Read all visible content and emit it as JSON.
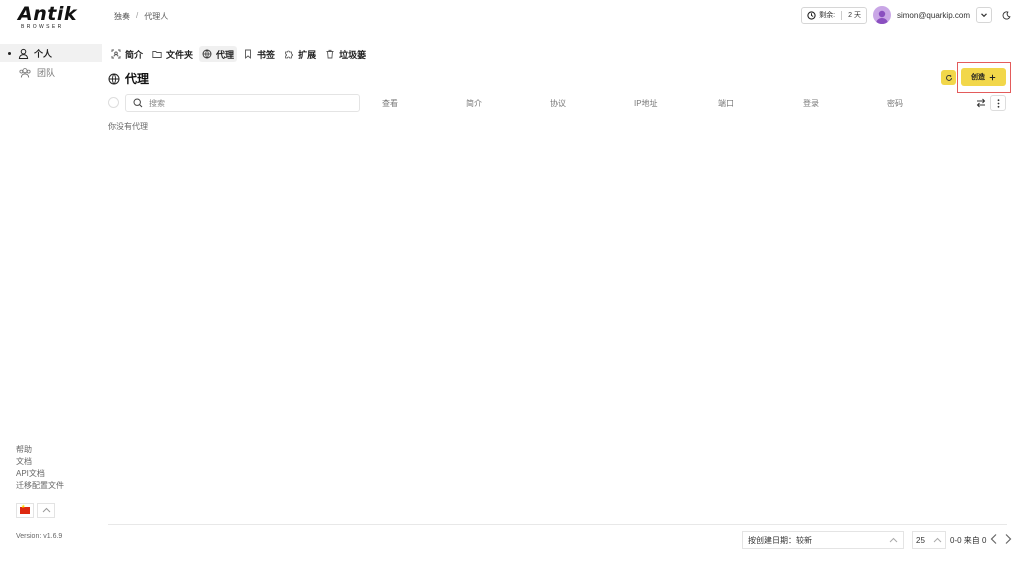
{
  "logo": {
    "main": "Antik",
    "sub": "BROWSER"
  },
  "breadcrumb": {
    "home": "独奏",
    "separator": "/",
    "current": "代理人"
  },
  "header": {
    "remaining_label": "剩余:",
    "remaining_value": "2 天",
    "email": "simon@quarkip.com"
  },
  "sidebar": {
    "items": [
      {
        "label": "个人",
        "icon": "user-icon"
      },
      {
        "label": "团队",
        "icon": "team-icon"
      }
    ]
  },
  "bottom_links": [
    "帮助",
    "文档",
    "API文档",
    "迁移配置文件"
  ],
  "version": "Version: v1.6.9",
  "tabs": [
    {
      "label": "简介",
      "icon": "profile-scan-icon"
    },
    {
      "label": "文件夹",
      "icon": "folder-icon"
    },
    {
      "label": "代理",
      "icon": "globe-icon"
    },
    {
      "label": "书签",
      "icon": "bookmark-icon"
    },
    {
      "label": "扩展",
      "icon": "puzzle-icon"
    },
    {
      "label": "垃圾篓",
      "icon": "trash-icon"
    }
  ],
  "page": {
    "title": "代理",
    "create_label": "创造"
  },
  "table": {
    "search_placeholder": "搜索",
    "columns": [
      "查看",
      "简介",
      "协议",
      "IP地址",
      "端口",
      "登录",
      "密码"
    ],
    "empty_text": "你没有代理"
  },
  "footer": {
    "sort_label": "按创建日期：较新",
    "per_page": "25",
    "page_info": "0-0 来自 0"
  },
  "colors": {
    "accent": "#f2d74a",
    "highlight": "#e35b5b"
  }
}
